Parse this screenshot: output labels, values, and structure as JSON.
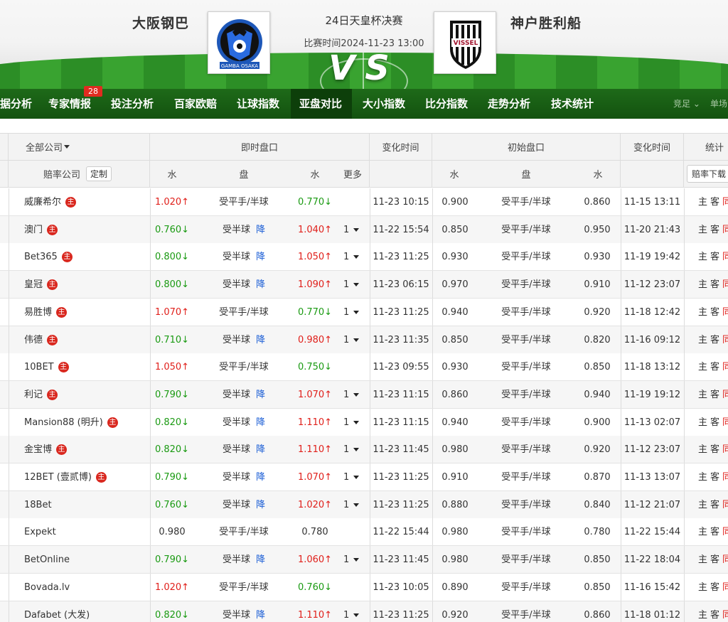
{
  "header": {
    "home_team": "大阪钢巴",
    "away_team": "神户胜利船",
    "match_title": "24日天皇杯决赛",
    "match_time": "比赛时间2024-11-23 13:00",
    "vs": "VS",
    "home_logo_text": "GAMBA OSAKA",
    "away_logo_text": "VISSEL"
  },
  "nav": {
    "items": [
      "据分析",
      "专家情报",
      "投注分析",
      "百家欧赔",
      "让球指数",
      "亚盘对比",
      "大小指数",
      "比分指数",
      "走势分析",
      "技术统计"
    ],
    "active": "亚盘对比",
    "badge": "28",
    "right_1": "竞足",
    "right_2": "单场"
  },
  "table": {
    "header1": {
      "company": "全部公司",
      "live": "即时盘口",
      "change_time": "变化时间",
      "initial": "初始盘口",
      "change_time2": "变化时间",
      "stats": "统计"
    },
    "header2": {
      "company": "赔率公司",
      "custom_btn": "定制",
      "water": "水",
      "handicap": "盘",
      "water2": "水",
      "more": "更多",
      "init_water": "水",
      "init_handicap": "盘",
      "init_water2": "水",
      "download_btn": "赔率下载"
    },
    "main_badge": "主",
    "drop_label": "降",
    "stats_labels": [
      "主",
      "客",
      "同"
    ],
    "rows": [
      {
        "company": "威廉希尔",
        "w1": "1.020↑",
        "w1c": "red",
        "hc": "受平手/半球",
        "drop": false,
        "w2": "0.770↓",
        "w2c": "green",
        "more": "",
        "time": "11-23 10:15",
        "iw1": "0.900",
        "ihc": "受平手/半球",
        "iw2": "0.860",
        "itime": "11-15 13:11"
      },
      {
        "company": "澳门",
        "w1": "0.760↓",
        "w1c": "green",
        "hc": "受半球",
        "drop": true,
        "w2": "1.040↑",
        "w2c": "red",
        "more": "1",
        "time": "11-22 15:54",
        "iw1": "0.850",
        "ihc": "受平手/半球",
        "iw2": "0.950",
        "itime": "11-20 21:43"
      },
      {
        "company": "Bet365",
        "w1": "0.800↓",
        "w1c": "green",
        "hc": "受半球",
        "drop": true,
        "w2": "1.050↑",
        "w2c": "red",
        "more": "1",
        "time": "11-23 11:25",
        "iw1": "0.930",
        "ihc": "受平手/半球",
        "iw2": "0.930",
        "itime": "11-19 19:42"
      },
      {
        "company": "皇冠",
        "w1": "0.800↓",
        "w1c": "green",
        "hc": "受半球",
        "drop": true,
        "w2": "1.090↑",
        "w2c": "red",
        "more": "1",
        "time": "11-23 06:15",
        "iw1": "0.970",
        "ihc": "受平手/半球",
        "iw2": "0.910",
        "itime": "11-12 23:07"
      },
      {
        "company": "易胜博",
        "w1": "1.070↑",
        "w1c": "red",
        "hc": "受平手/半球",
        "drop": false,
        "w2": "0.770↓",
        "w2c": "green",
        "more": "1",
        "time": "11-23 11:25",
        "iw1": "0.940",
        "ihc": "受平手/半球",
        "iw2": "0.920",
        "itime": "11-18 12:42"
      },
      {
        "company": "伟德",
        "w1": "0.710↓",
        "w1c": "green",
        "hc": "受半球",
        "drop": true,
        "w2": "0.980↑",
        "w2c": "red",
        "more": "1",
        "time": "11-23 11:35",
        "iw1": "0.850",
        "ihc": "受平手/半球",
        "iw2": "0.820",
        "itime": "11-16 09:12"
      },
      {
        "company": "10BET",
        "w1": "1.050↑",
        "w1c": "red",
        "hc": "受平手/半球",
        "drop": false,
        "w2": "0.750↓",
        "w2c": "green",
        "more": "",
        "time": "11-23 09:55",
        "iw1": "0.930",
        "ihc": "受平手/半球",
        "iw2": "0.850",
        "itime": "11-18 13:12"
      },
      {
        "company": "利记",
        "w1": "0.790↓",
        "w1c": "green",
        "hc": "受半球",
        "drop": true,
        "w2": "1.070↑",
        "w2c": "red",
        "more": "1",
        "time": "11-23 11:15",
        "iw1": "0.860",
        "ihc": "受平手/半球",
        "iw2": "0.940",
        "itime": "11-19 19:12"
      },
      {
        "company": "Mansion88 (明升)",
        "w1": "0.820↓",
        "w1c": "green",
        "hc": "受半球",
        "drop": true,
        "w2": "1.110↑",
        "w2c": "red",
        "more": "1",
        "time": "11-23 11:15",
        "iw1": "0.940",
        "ihc": "受平手/半球",
        "iw2": "0.900",
        "itime": "11-13 02:07"
      },
      {
        "company": "金宝博",
        "w1": "0.820↓",
        "w1c": "green",
        "hc": "受半球",
        "drop": true,
        "w2": "1.110↑",
        "w2c": "red",
        "more": "1",
        "time": "11-23 11:45",
        "iw1": "0.980",
        "ihc": "受平手/半球",
        "iw2": "0.920",
        "itime": "11-12 23:07"
      },
      {
        "company": "12BET (壹贰博)",
        "w1": "0.790↓",
        "w1c": "green",
        "hc": "受半球",
        "drop": true,
        "w2": "1.070↑",
        "w2c": "red",
        "more": "1",
        "time": "11-23 11:25",
        "iw1": "0.910",
        "ihc": "受平手/半球",
        "iw2": "0.870",
        "itime": "11-13 13:07"
      },
      {
        "company": "18Bet",
        "w1": "0.760↓",
        "w1c": "green",
        "hc": "受半球",
        "drop": true,
        "w2": "1.020↑",
        "w2c": "red",
        "more": "1",
        "time": "11-23 11:25",
        "iw1": "0.880",
        "ihc": "受平手/半球",
        "iw2": "0.840",
        "itime": "11-12 21:07"
      },
      {
        "company": "Expekt",
        "w1": "0.980",
        "w1c": "",
        "hc": "受平手/半球",
        "drop": false,
        "w2": "0.780",
        "w2c": "",
        "more": "",
        "time": "11-22 15:44",
        "iw1": "0.980",
        "ihc": "受平手/半球",
        "iw2": "0.780",
        "itime": "11-22 15:44"
      },
      {
        "company": "BetOnline",
        "w1": "0.790↓",
        "w1c": "green",
        "hc": "受半球",
        "drop": true,
        "w2": "1.060↑",
        "w2c": "red",
        "more": "1",
        "time": "11-23 11:45",
        "iw1": "0.980",
        "ihc": "受平手/半球",
        "iw2": "0.850",
        "itime": "11-22 18:04"
      },
      {
        "company": "Bovada.lv",
        "w1": "1.020↑",
        "w1c": "red",
        "hc": "受平手/半球",
        "drop": false,
        "w2": "0.760↓",
        "w2c": "green",
        "more": "",
        "time": "11-23 10:05",
        "iw1": "0.890",
        "ihc": "受平手/半球",
        "iw2": "0.850",
        "itime": "11-16 15:42"
      },
      {
        "company": "Dafabet (大发)",
        "w1": "0.820↓",
        "w1c": "green",
        "hc": "受半球",
        "drop": true,
        "w2": "1.110↑",
        "w2c": "red",
        "more": "1",
        "time": "11-23 11:25",
        "iw1": "0.920",
        "ihc": "受平手/半球",
        "iw2": "0.860",
        "itime": "11-18 01:12"
      }
    ],
    "main_flags": [
      true,
      true,
      true,
      true,
      true,
      true,
      true,
      true,
      true,
      true,
      true,
      false,
      false,
      false,
      false,
      false
    ]
  }
}
